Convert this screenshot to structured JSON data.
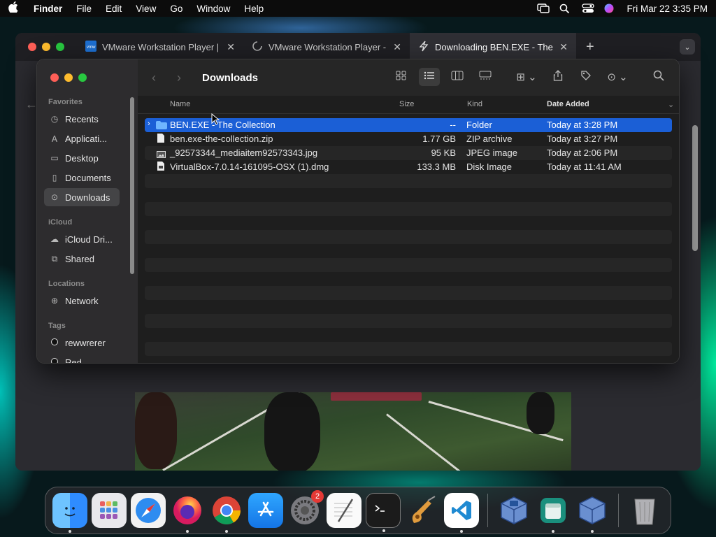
{
  "menubar": {
    "app": "Finder",
    "items": [
      "File",
      "Edit",
      "View",
      "Go",
      "Window",
      "Help"
    ],
    "datetime": "Fri Mar 22  3:35 PM"
  },
  "browser": {
    "tabs": [
      {
        "title": "VMware Workstation Player |",
        "icon": "vmware-icon"
      },
      {
        "title": "VMware Workstation Player -",
        "icon": "loading-spinner-icon"
      },
      {
        "title": "Downloading BEN.EXE - The",
        "icon": "lightning-icon"
      }
    ]
  },
  "finder": {
    "title": "Downloads",
    "sidebar": {
      "sections": [
        {
          "label": "Favorites",
          "items": [
            {
              "label": "Recents",
              "icon": "clock-icon"
            },
            {
              "label": "Applicati...",
              "icon": "applications-icon"
            },
            {
              "label": "Desktop",
              "icon": "desktop-icon"
            },
            {
              "label": "Documents",
              "icon": "document-icon"
            },
            {
              "label": "Downloads",
              "icon": "downloads-icon",
              "selected": true
            }
          ]
        },
        {
          "label": "iCloud",
          "items": [
            {
              "label": "iCloud Dri...",
              "icon": "cloud-icon"
            },
            {
              "label": "Shared",
              "icon": "shared-folder-icon"
            }
          ]
        },
        {
          "label": "Locations",
          "items": [
            {
              "label": "Network",
              "icon": "network-icon"
            }
          ]
        },
        {
          "label": "Tags",
          "items": [
            {
              "label": "rewwrerer",
              "icon": "tag-dot-icon"
            },
            {
              "label": "Red",
              "icon": "tag-dot-icon"
            }
          ]
        }
      ]
    },
    "columns": [
      "Name",
      "Size",
      "Kind",
      "Date Added"
    ],
    "files": [
      {
        "name": "BEN.EXE - The Collection",
        "size": "--",
        "kind": "Folder",
        "date": "Today at 3:28 PM",
        "selected": true
      },
      {
        "name": "ben.exe-the-collection.zip",
        "size": "1.77 GB",
        "kind": "ZIP archive",
        "date": "Today at 3:27 PM"
      },
      {
        "name": "_92573344_mediaitem92573343.jpg",
        "size": "95 KB",
        "kind": "JPEG image",
        "date": "Today at 2:06 PM"
      },
      {
        "name": "VirtualBox-7.0.14-161095-OSX (1).dmg",
        "size": "133.3 MB",
        "kind": "Disk Image",
        "date": "Today at 11:41 AM"
      }
    ]
  },
  "dock": {
    "items": [
      "finder",
      "launchpad",
      "safari",
      "firefox",
      "chrome",
      "app-store",
      "system-settings",
      "textedit",
      "terminal",
      "garageband",
      "vscode",
      "virtualbox",
      "disk-utility",
      "virtualbox-vm",
      "trash"
    ],
    "system_settings_badge": "2"
  }
}
